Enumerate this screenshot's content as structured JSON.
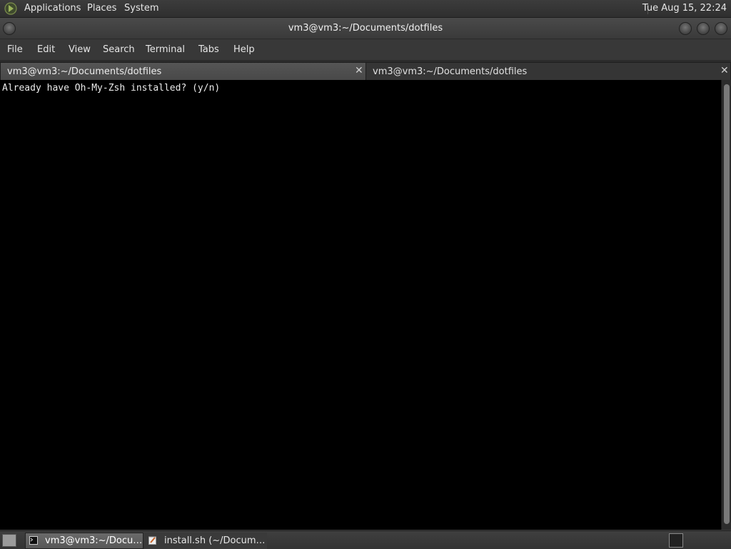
{
  "topbar": {
    "logo_icon": "gnome-foot-icon",
    "menus": [
      "Applications",
      "Places",
      "System"
    ],
    "clock": "Tue Aug 15, 22:24"
  },
  "window": {
    "title": "vm3@vm3:~/Documents/dotfiles",
    "menubar": [
      "File",
      "Edit",
      "View",
      "Search",
      "Terminal",
      "Tabs",
      "Help"
    ],
    "tabs": [
      {
        "label": "vm3@vm3:~/Documents/dotfiles",
        "active": false
      },
      {
        "label": "vm3@vm3:~/Documents/dotfiles",
        "active": true
      }
    ],
    "terminal_output": "Already have Oh-My-Zsh installed? (y/n)"
  },
  "taskbar": {
    "items": [
      {
        "label": "vm3@vm3:~/Docu…",
        "icon": "terminal-icon",
        "active": true
      },
      {
        "label": "install.sh (~/Docum…",
        "icon": "text-editor-icon",
        "active": false
      }
    ]
  }
}
